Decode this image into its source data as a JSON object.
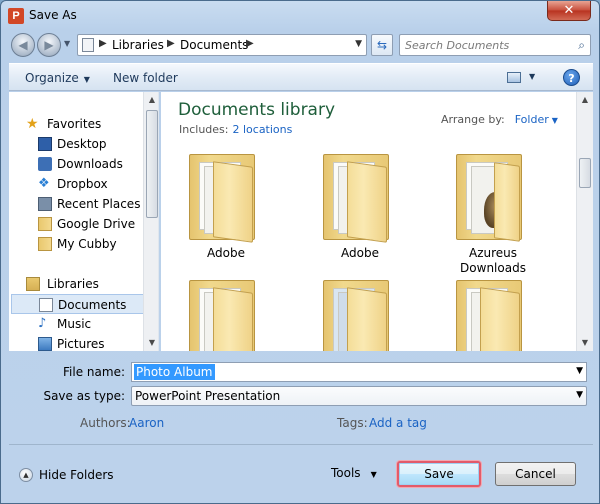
{
  "window": {
    "title": "Save As",
    "app_icon_letter": "P",
    "close_symbol": "✕"
  },
  "nav": {
    "back_symbol": "◀",
    "forward_symbol": "▶",
    "breadcrumb": [
      "Libraries",
      "Documents"
    ],
    "breadcrumb_separator": "▶",
    "refresh_symbol": "⇆",
    "search_placeholder": "Search Documents"
  },
  "toolbar": {
    "organize_label": "Organize",
    "new_folder_label": "New folder",
    "help_symbol": "?"
  },
  "sidebar": {
    "favorites_label": "Favorites",
    "favorites": [
      "Desktop",
      "Downloads",
      "Dropbox",
      "Recent Places",
      "Google Drive",
      "My Cubby"
    ],
    "libraries_label": "Libraries",
    "libraries": [
      "Documents",
      "Music",
      "Pictures"
    ],
    "selected": "Documents"
  },
  "content": {
    "title": "Documents library",
    "includes_label": "Includes:",
    "includes_link": "2 locations",
    "arrange_label": "Arrange by:",
    "arrange_value": "Folder",
    "folders": [
      "Adobe",
      "Adobe",
      "Azureus Downloads",
      "",
      "",
      ""
    ]
  },
  "form": {
    "file_name_label": "File name:",
    "file_name_value": "Photo Album",
    "save_as_type_label": "Save as type:",
    "save_as_type_value": "PowerPoint Presentation",
    "authors_label": "Authors:",
    "authors_value": "Aaron",
    "tags_label": "Tags:",
    "tags_value": "Add a tag"
  },
  "footer": {
    "hide_folders_label": "Hide Folders",
    "tools_label": "Tools",
    "save_label": "Save",
    "cancel_label": "Cancel"
  },
  "colors": {
    "accent_link": "#1a63c4",
    "library_title": "#1e5e3a",
    "save_highlight": "#e25b6a"
  }
}
